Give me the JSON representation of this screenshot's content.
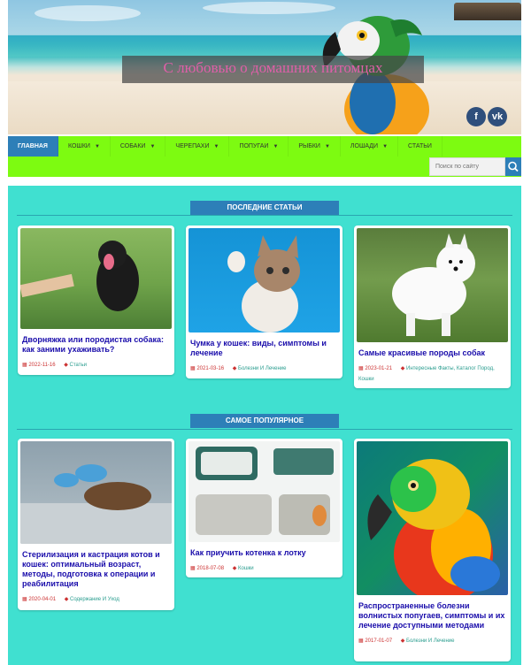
{
  "header": {
    "site_title": "С любовью о домашних питомцах",
    "social": [
      {
        "label": "f",
        "icon": "facebook-icon"
      },
      {
        "label": "vk",
        "icon": "vk-icon"
      }
    ]
  },
  "nav": {
    "items": [
      {
        "label": "Главная",
        "dropdown": false,
        "active": true
      },
      {
        "label": "Кошки",
        "dropdown": true
      },
      {
        "label": "Собаки",
        "dropdown": true
      },
      {
        "label": "Черепахи",
        "dropdown": true
      },
      {
        "label": "Попугаи",
        "dropdown": true
      },
      {
        "label": "Рыбки",
        "dropdown": true
      },
      {
        "label": "Лошади",
        "dropdown": true
      },
      {
        "label": "Статьи",
        "dropdown": false
      }
    ],
    "search_placeholder": "Поиск по сайту"
  },
  "sections": {
    "latest": {
      "title": "Последние статьи",
      "cards": [
        {
          "title": "Дворняжка или породистая собака: как заними ухаживать?",
          "date": "2022-11-16",
          "category": "Статьи"
        },
        {
          "title": "Чумка у кошек: виды, симптомы и лечение",
          "date": "2021-03-16",
          "category": "Болезни И Лечение"
        },
        {
          "title": "Самые красивые породы собак",
          "date": "2023-01-21",
          "category": "Интересные Факты, Каталог Пород, Кошки"
        }
      ]
    },
    "popular": {
      "title": "Самое популярное",
      "cards": [
        {
          "title": "Стерилизация и кастрация котов и кошек: оптимальный возраст, методы, подготовка к операции и реабилитация",
          "date": "2020-04-01",
          "category": "Содержание И Уход"
        },
        {
          "title": "Как приучить котенка к лотку",
          "date": "2018-07-08",
          "category": "Кошки"
        },
        {
          "title": "Распространенные болезни волнистых попугаев, симптомы и их лечение доступными методами",
          "date": "2017-01-07",
          "category": "Болезни И Лечение"
        }
      ]
    }
  },
  "colors": {
    "nav_bg": "#7dfb11",
    "accent": "#2d7fb8",
    "content_bg": "#40e0d0",
    "link": "#1a0dab"
  }
}
